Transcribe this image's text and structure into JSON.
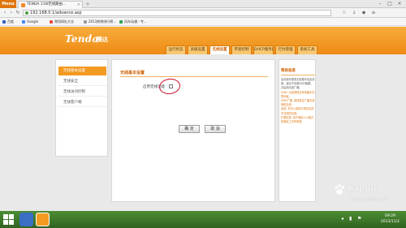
{
  "browser": {
    "menu_label": "Menu",
    "tab_title": "TENDA 11N无线路由...",
    "url": "192.168.0.1/advance.asp",
    "bookmarks": [
      "百度",
      "Google",
      "常用网址大全",
      "2013热销排行榜...",
      "风车动漫 - 专..."
    ]
  },
  "router": {
    "logo": "Tenda",
    "logo_cn": "腾达",
    "nav": [
      {
        "label": "运行状态",
        "active": false
      },
      {
        "label": "高级设置",
        "active": false
      },
      {
        "label": "无线设置",
        "active": true
      },
      {
        "label": "带宽控制",
        "active": false
      },
      {
        "label": "DHCP服务器",
        "active": false
      },
      {
        "label": "行为管理",
        "active": false
      },
      {
        "label": "系统工具",
        "active": false
      }
    ],
    "sidebar": [
      {
        "label": "无线基本设置",
        "active": true
      },
      {
        "label": "无线安全",
        "active": false
      },
      {
        "label": "无线访问控制",
        "active": false
      },
      {
        "label": "无线客户端",
        "active": false
      }
    ],
    "content": {
      "title": "无线基本设置",
      "enable_label": "启用无线功能",
      "enable_checked": false,
      "ok_label": "确 定",
      "cancel_label": "取 消"
    },
    "help": {
      "title": "帮助信息",
      "paragraphs": [
        "此页面可更改无线基本信息设置。建议不设置SSID隐藏，并启用无线广播。",
        "SSID: 无线网络名称设备中列表设置。",
        "SSID广播: 选择是否广播无线网络名称。",
        "信道: 您可以选择与周边无线不冲突的信道。",
        "扩展信道: 用于确定11n模式的频段工作的带宽。"
      ]
    }
  },
  "watermark": {
    "brand": "Bai du",
    "sub": "jingyan.baidu.com"
  },
  "taskbar": {
    "time": "09:29",
    "date": "2013/11/2"
  },
  "colors": {
    "accent": "#f39a22",
    "taskbar": "#3e7a2a",
    "annotation": "#c8102e"
  }
}
